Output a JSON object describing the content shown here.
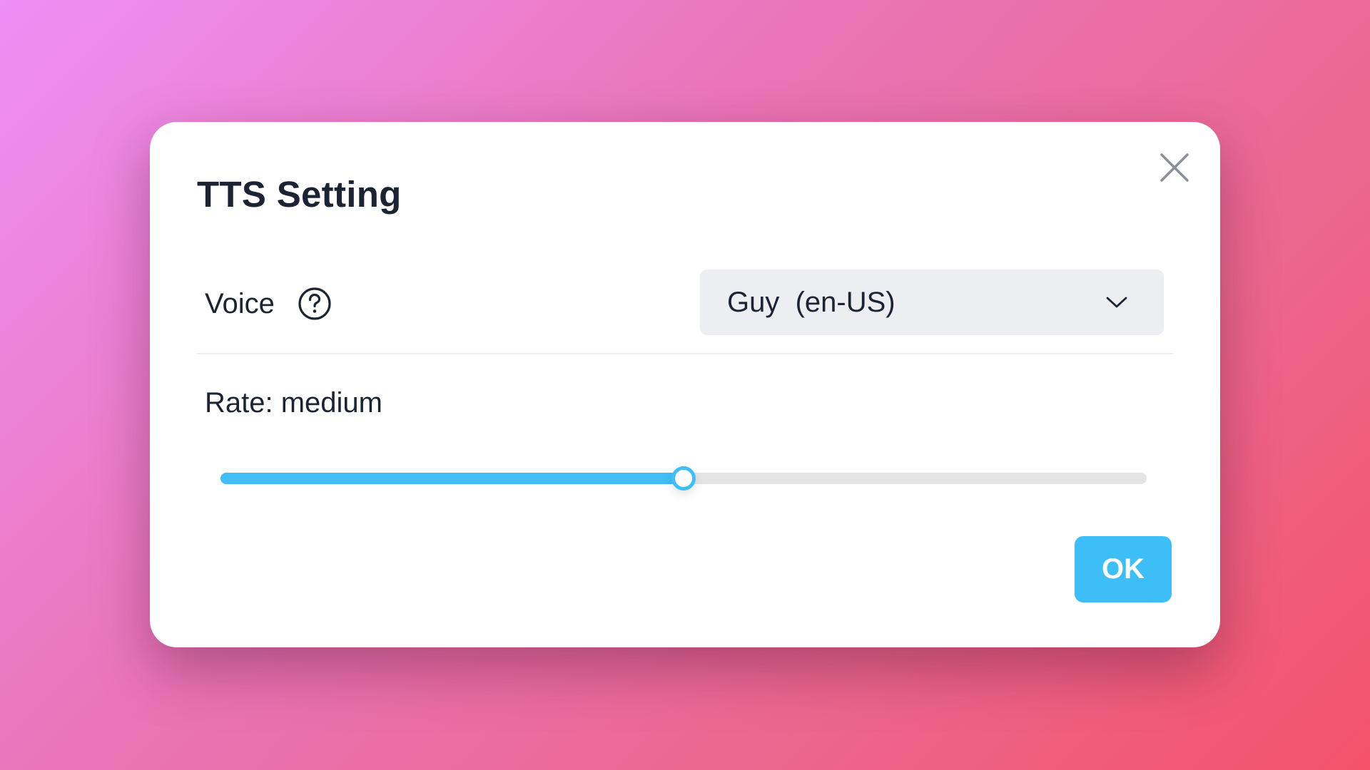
{
  "dialog": {
    "title": "TTS Setting",
    "close_icon": "close-icon"
  },
  "voice": {
    "label": "Voice",
    "help_icon": "help-circle-icon",
    "selected": "Guy  (en-US)",
    "dropdown_icon": "chevron-down-icon"
  },
  "rate": {
    "label": "Rate: medium",
    "slider_value": 0.5,
    "accent_color": "#3fbef7"
  },
  "footer": {
    "ok_label": "OK"
  }
}
